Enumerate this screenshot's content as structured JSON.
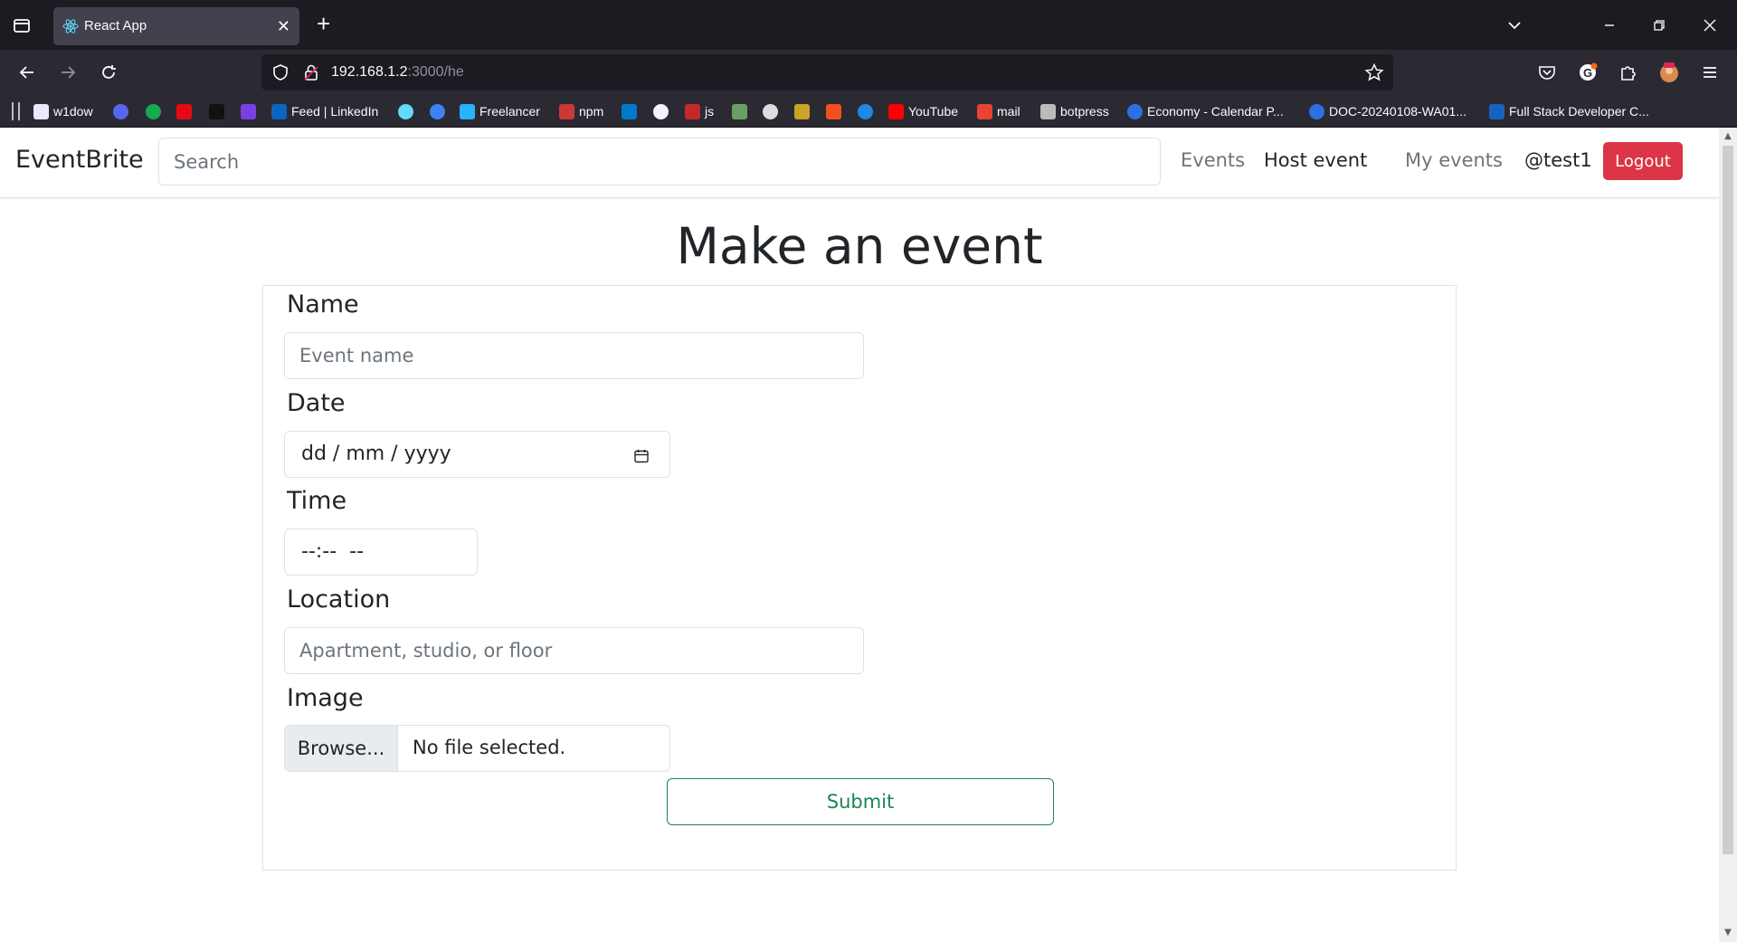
{
  "browser": {
    "tab_title": "React App",
    "tab_close": "✕",
    "new_tab": "+",
    "url_host": "192.168.1.2",
    "url_rest": ":3000/he",
    "bookmarks": [
      {
        "label": "w1dow",
        "color": "#e8e8ff"
      },
      {
        "label": "",
        "color": "#5865f2"
      },
      {
        "label": "",
        "color": "#13aa52"
      },
      {
        "label": "",
        "color": "#e50914"
      },
      {
        "label": "",
        "color": "#111111"
      },
      {
        "label": "",
        "color": "#7b3fe4"
      },
      {
        "label": "Feed | LinkedIn",
        "color": "#0a66c2"
      },
      {
        "label": "",
        "color": "#61dafb"
      },
      {
        "label": "",
        "color": "#3b82f6"
      },
      {
        "label": "Freelancer",
        "color": "#29b2fe"
      },
      {
        "label": "npm",
        "color": "#cb3837"
      },
      {
        "label": "",
        "color": "#007acc"
      },
      {
        "label": "",
        "color": "#f0f6fc"
      },
      {
        "label": "js",
        "color": "#c62828"
      },
      {
        "label": "",
        "color": "#68a063"
      },
      {
        "label": "",
        "color": "#dddddd"
      },
      {
        "label": "",
        "color": "#c9a227"
      },
      {
        "label": "",
        "color": "#f24e1e"
      },
      {
        "label": "",
        "color": "#1e88e5"
      },
      {
        "label": "YouTube",
        "color": "#ff0000"
      },
      {
        "label": "mail",
        "color": "#ea4335"
      },
      {
        "label": "botpress",
        "color": "#bbbbbb"
      },
      {
        "label": "Economy - Calendar P...",
        "color": "#2f6fe4"
      },
      {
        "label": "DOC-20240108-WA01...",
        "color": "#2f6fe4"
      },
      {
        "label": "Full Stack Developer C...",
        "color": "#1565c0"
      }
    ]
  },
  "app": {
    "brand": "EventBrite",
    "search_placeholder": "Search",
    "nav": {
      "events": "Events",
      "host_event": "Host event",
      "my_events": "My events",
      "user": "@test1",
      "logout": "Logout"
    },
    "title": "Make an event",
    "form": {
      "name_label": "Name",
      "name_placeholder": "Event name",
      "date_label": "Date",
      "date_placeholder": "dd / mm / yyyy",
      "time_label": "Time",
      "time_placeholder": "--:--  --",
      "location_label": "Location",
      "location_placeholder": "Apartment, studio, or floor",
      "image_label": "Image",
      "browse_label": "Browse...",
      "no_file": "No file selected.",
      "submit": "Submit"
    }
  },
  "colors": {
    "logout_bg": "#dc3545",
    "submit_accent": "#198754",
    "chrome_dark": "#1c1b22",
    "chrome_toolbar": "#2b2a33"
  }
}
